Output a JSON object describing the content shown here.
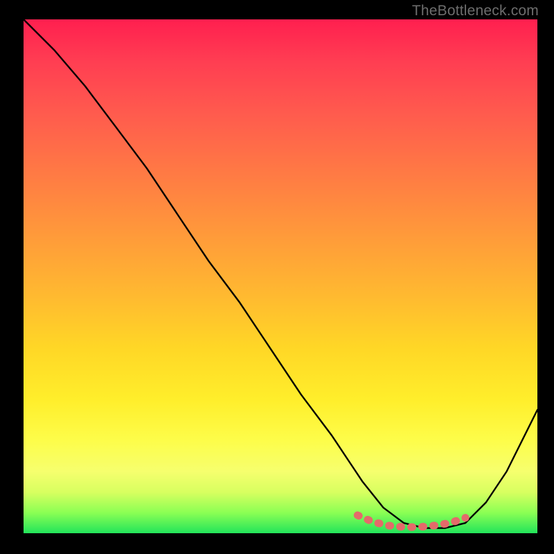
{
  "attribution": "TheBottleneck.com",
  "chart_data": {
    "type": "line",
    "title": "",
    "xlabel": "",
    "ylabel": "",
    "xlim": [
      0,
      100
    ],
    "ylim": [
      0,
      100
    ],
    "series": [
      {
        "name": "bottleneck-curve",
        "x": [
          0,
          6,
          12,
          18,
          24,
          30,
          36,
          42,
          48,
          54,
          60,
          66,
          70,
          74,
          78,
          82,
          86,
          90,
          94,
          100
        ],
        "y": [
          100,
          94,
          87,
          79,
          71,
          62,
          53,
          45,
          36,
          27,
          19,
          10,
          5,
          2,
          1,
          1,
          2,
          6,
          12,
          24
        ]
      },
      {
        "name": "highlight-segment",
        "x": [
          65,
          68,
          71,
          74,
          77,
          80,
          83,
          86
        ],
        "y": [
          3.5,
          2.2,
          1.5,
          1.2,
          1.2,
          1.5,
          2.0,
          3.0
        ]
      }
    ],
    "colors": {
      "curve": "#000000",
      "highlight": "#e46a6a"
    }
  }
}
